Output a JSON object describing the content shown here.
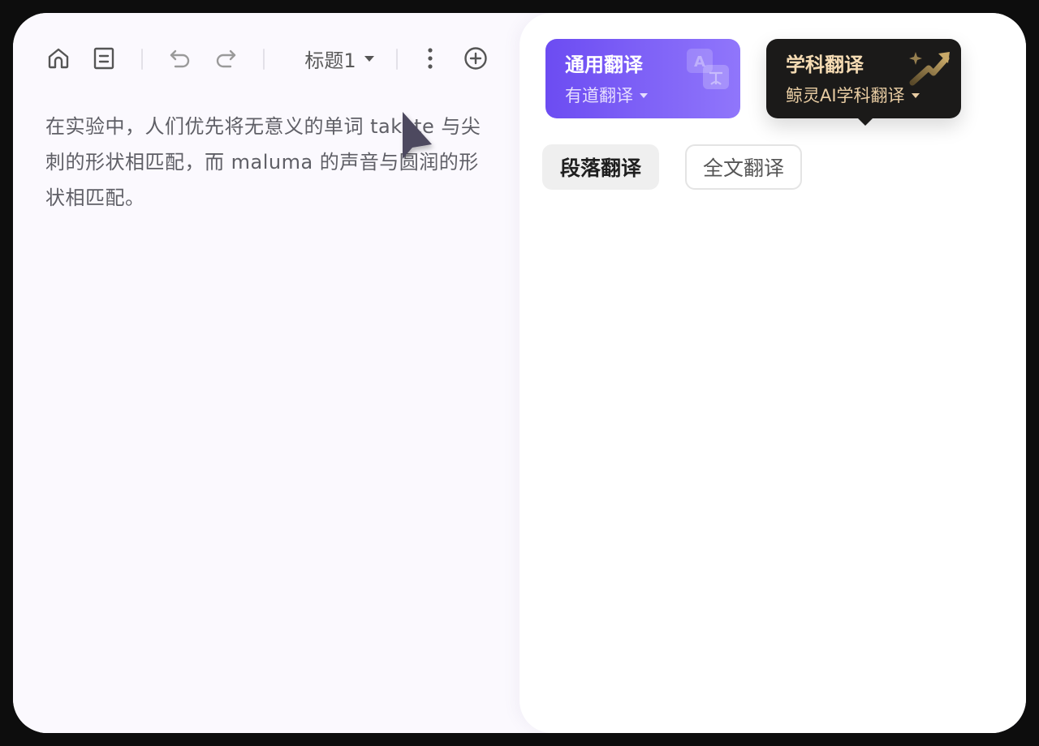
{
  "toolbar": {
    "icons": [
      "home-icon",
      "document-icon",
      "undo-icon",
      "redo-icon",
      "more-vertical-icon",
      "add-circle-icon"
    ],
    "heading_select": "标题1"
  },
  "editor": {
    "paragraph": "在实验中，人们优先将无意义的单词 takete 与尖刺的形状相匹配，而 maluma 的声音与圆润的形状相匹配。"
  },
  "translate_cards": {
    "general": {
      "title": "通用翻译",
      "engine": "有道翻译",
      "icon": "translate-badge-icon",
      "color": "#6c4cf2"
    },
    "subject": {
      "title": "学科翻译",
      "engine": "鲸灵AI学科翻译",
      "icon": "sparkle-arrow-icon",
      "color": "#1b1a19"
    }
  },
  "modes": {
    "paragraph": "段落翻译",
    "full_text": "全文翻译"
  }
}
